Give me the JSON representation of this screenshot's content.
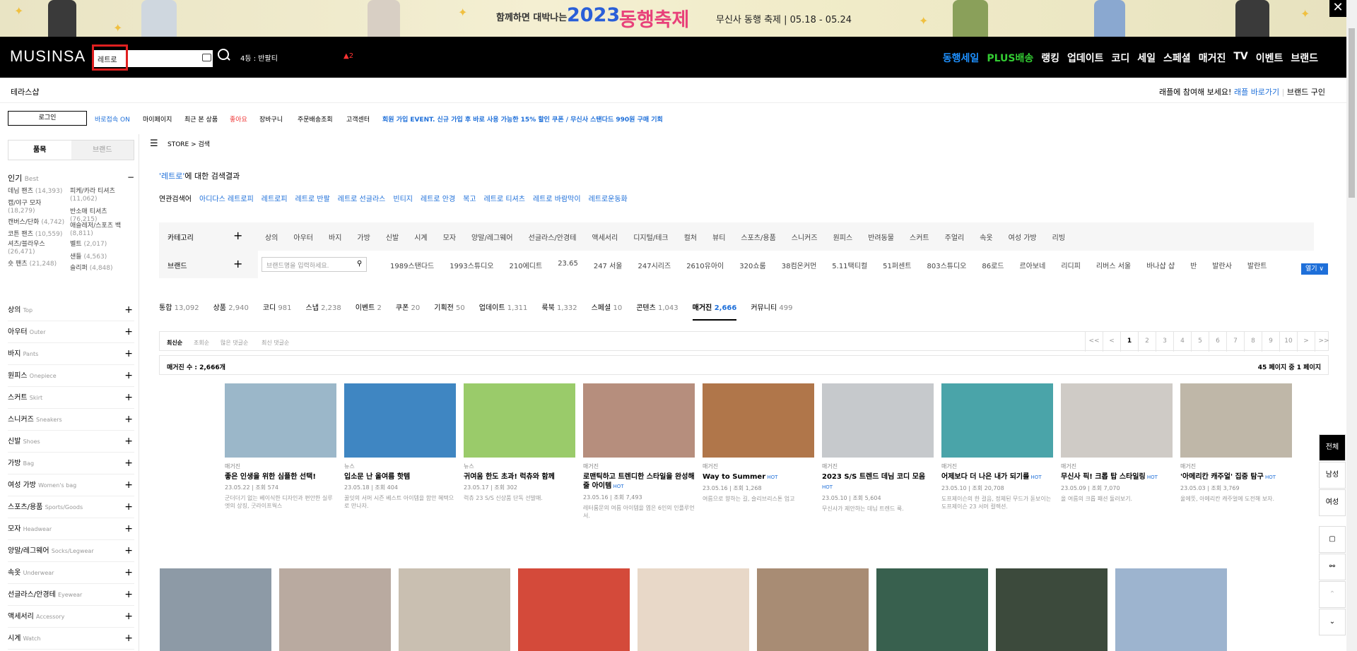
{
  "banner": {
    "subtitle": "함께하면 대박나는",
    "year": "2023",
    "festival": "동행축제",
    "info": "무신사 동행 축제  |  05.18 - 05.24",
    "close": "✕"
  },
  "header": {
    "logo": "MUSINSA",
    "search_value": "레트로",
    "rank": "4등 : 반팔티",
    "rank_change": "▲2",
    "gnb": [
      {
        "label": "동행세일",
        "color": "blue"
      },
      {
        "label": "PLUS배송",
        "color": "green"
      },
      {
        "label": "랭킹"
      },
      {
        "label": "업데이트"
      },
      {
        "label": "코디"
      },
      {
        "label": "세일"
      },
      {
        "label": "스페셜"
      },
      {
        "label": "매거진"
      },
      {
        "label": "TV"
      },
      {
        "label": "이벤트"
      },
      {
        "label": "브랜드"
      }
    ]
  },
  "subheader": {
    "left": "테라스샵",
    "right_text": "래플에 참여해 보세요!",
    "right_link": "래플 바로가기",
    "right_sep": "|",
    "right_last": "브랜드 구인"
  },
  "util": {
    "login": "로그인",
    "items": [
      "바로접속 ON",
      "마이페이지",
      "최근 본 상품",
      "좋아요",
      "장바구니",
      "주문배송조회",
      "고객센터"
    ],
    "promo": "회원 가입 EVENT. 신규 가입 후 바로 사용 가능한 15% 할인 쿠폰 / 무신사 스탠다드 990원 구매 기회"
  },
  "sidebar": {
    "tabs": [
      "품목",
      "브랜드"
    ],
    "popular_title": "인기",
    "popular_sub": "Best",
    "popular_minus": "−",
    "popular": [
      {
        "name": "데님 팬츠",
        "count": "(14,393)"
      },
      {
        "name": "피케/카라 티셔츠",
        "count": "(11,062)"
      },
      {
        "name": "캡/야구 모자",
        "count": "(18,279)"
      },
      {
        "name": "반소매 티셔츠",
        "count": "(76,215)"
      },
      {
        "name": "캔버스/단화",
        "count": "(4,742)"
      },
      {
        "name": "애슬레저/스포츠 백",
        "count": "(8,811)"
      },
      {
        "name": "코튼 팬츠",
        "count": "(10,559)"
      },
      {
        "name": "벨트",
        "count": "(2,017)"
      },
      {
        "name": "셔츠/블라우스",
        "count": "(26,471)"
      },
      {
        "name": "샌들",
        "count": "(4,563)"
      },
      {
        "name": "숏 팬츠",
        "count": "(21,248)"
      },
      {
        "name": "슬리퍼",
        "count": "(4,848)"
      }
    ],
    "categories": [
      {
        "ko": "상의",
        "en": "Top"
      },
      {
        "ko": "아우터",
        "en": "Outer"
      },
      {
        "ko": "바지",
        "en": "Pants"
      },
      {
        "ko": "원피스",
        "en": "Onepiece"
      },
      {
        "ko": "스커트",
        "en": "Skirt"
      },
      {
        "ko": "스니커즈",
        "en": "Sneakers"
      },
      {
        "ko": "신발",
        "en": "Shoes"
      },
      {
        "ko": "가방",
        "en": "Bag"
      },
      {
        "ko": "여성 가방",
        "en": "Women's bag"
      },
      {
        "ko": "스포츠/용품",
        "en": "Sports/Goods"
      },
      {
        "ko": "모자",
        "en": "Headwear"
      },
      {
        "ko": "양말/레그웨어",
        "en": "Socks/Legwear"
      },
      {
        "ko": "속옷",
        "en": "Underwear"
      },
      {
        "ko": "선글라스/안경테",
        "en": "Eyewear"
      },
      {
        "ko": "액세서리",
        "en": "Accessory"
      },
      {
        "ko": "시계",
        "en": "Watch"
      }
    ]
  },
  "breadcrumb": "STORE  >  검색",
  "result": {
    "keyword": "'레트로'",
    "suffix": "에 대한 검색결과"
  },
  "related": {
    "label": "연관검색어",
    "items": [
      "아디다스 레트로피",
      "레트로피",
      "레트로 반팔",
      "레트로 선글라스",
      "빈티지",
      "레트로 안경",
      "복고",
      "레트로 티셔츠",
      "레트로 바람막이",
      "레트로운동화"
    ]
  },
  "filter": {
    "category_label": "카테고리",
    "category_items": [
      "상의",
      "아우터",
      "바지",
      "가방",
      "신발",
      "시계",
      "모자",
      "양말/레그웨어",
      "선글라스/안경테",
      "액세서리",
      "디지털/테크",
      "컬처",
      "뷰티",
      "스포츠/용품",
      "스니커즈",
      "원피스",
      "반려동물",
      "스커트",
      "주얼리",
      "속옷",
      "여성 가방",
      "리빙"
    ],
    "brand_label": "브랜드",
    "brand_placeholder": "브랜드명을 입력하세요.",
    "brand_items": [
      "1989스탠다드",
      "1993스튜디오",
      "210에디트",
      "23.65",
      "247 서울",
      "247시리즈",
      "2610유아이",
      "320쇼룸",
      "38컴온커먼",
      "5.11택티컬",
      "51퍼센트",
      "803스튜디오",
      "86로드",
      "르아보네",
      "리디피",
      "리버스 서울",
      "바나샵 샵",
      "반",
      "발란사",
      "발란트"
    ],
    "open": "열기 ∨",
    "plus": "+"
  },
  "tabs": [
    {
      "label": "통합",
      "n": "13,092"
    },
    {
      "label": "상품",
      "n": "2,940"
    },
    {
      "label": "코디",
      "n": "981"
    },
    {
      "label": "스냅",
      "n": "2,238"
    },
    {
      "label": "이벤트",
      "n": "2"
    },
    {
      "label": "쿠폰",
      "n": "20"
    },
    {
      "label": "기획전",
      "n": "50"
    },
    {
      "label": "업데이트",
      "n": "1,311"
    },
    {
      "label": "룩북",
      "n": "1,332"
    },
    {
      "label": "스페셜",
      "n": "10"
    },
    {
      "label": "콘텐츠",
      "n": "1,043"
    },
    {
      "label": "매거진",
      "n": "2,666",
      "active": true
    },
    {
      "label": "커뮤니티",
      "n": "499"
    }
  ],
  "sort": [
    "최신순",
    "조회순",
    "많은 댓글순",
    "최신 댓글순"
  ],
  "pages": [
    "<<",
    "<",
    "1",
    "2",
    "3",
    "4",
    "5",
    "6",
    "7",
    "8",
    "9",
    "10",
    ">",
    ">>"
  ],
  "count": {
    "left": "매거진 수 : 2,666개",
    "right": "45 페이지 중 1 페이지"
  },
  "cards": [
    {
      "kind": "매거진",
      "title": "좋은 인생을 위한 심플한 선택!",
      "meta": "23.05.22  |  조회 574",
      "desc": "군더더기 없는 베이식한 디자인과 편안한 실루엣의 상징, 굿라이프웍스",
      "color": "#9bb7c9"
    },
    {
      "kind": "뉴스",
      "title": "입소문 난 올여름 핫템",
      "meta": "23.05.18  |  조회 404",
      "desc": "꿀잇의 서머 시즌 베스트 아이템을 함안 혜택으로 만나자.",
      "color": "#3f86c2"
    },
    {
      "kind": "뉴스",
      "title": "귀여움 한도 초과! 럭츄와 함께",
      "meta": "23.05.17  |  조회 302",
      "desc": "럭츄 23 S/S 신상품 단독 선발매.",
      "color": "#9acb6a"
    },
    {
      "kind": "매거진",
      "title": "로맨틱하고 트렌디한 스타일을 완성해 줄 아이템",
      "meta": "23.05.16  |  조회 7,493",
      "desc": "레터룸문의 여름 아이템을 엽은 6인의 인플루언서.",
      "color": "#b68e7d"
    },
    {
      "kind": "매거진",
      "title": "Way to Summer",
      "meta": "23.05.16  |  조회 1,268",
      "desc": "여름으로 향하는 길, 슬리브리스톤 업고",
      "color": "#b0764a"
    },
    {
      "kind": "매거진",
      "title": "2023 S/S 트렌드 데님 코디 모음",
      "meta": "23.05.10  |  조회 5,604",
      "desc": "무신사가 제안하는 데님 트렌드 룩.",
      "color": "#c6c9cc"
    },
    {
      "kind": "매거진",
      "title": "어제보다 더 나은 내가 되기를",
      "meta": "23.05.10  |  조회 20,708",
      "desc": "도프제이슨의 한 걸음, 정체된 무드가 돋보이는 도프제이슨 23 서머 컬렉션.",
      "color": "#4aa4a9"
    },
    {
      "kind": "매거진",
      "title": "무신사 픽! 크롭 탑 스타일링",
      "meta": "23.05.09  |  조회 7,070",
      "desc": "올 여름의 크롭 패션 둘러보기.",
      "color": "#cfcbc6"
    },
    {
      "kind": "매거진",
      "title": "'아메리칸 캐주얼' 집중 탐구",
      "meta": "23.05.03  |  조회 3,769",
      "desc": "울에뜻, 아메리칸 캐주얼에 도전해 보자.",
      "color": "#bfb7a8"
    }
  ],
  "rail": [
    "전체",
    "남성",
    "여성"
  ]
}
